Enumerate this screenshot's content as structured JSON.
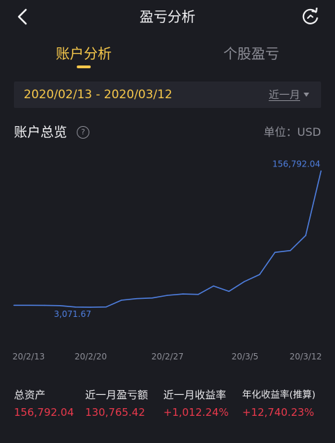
{
  "nav": {
    "title": "盈亏分析",
    "back_icon": "chevron-left-icon",
    "refresh_icon": "refresh-icon"
  },
  "tabs": [
    {
      "label": "账户分析",
      "active": true
    },
    {
      "label": "个股盈亏",
      "active": false
    }
  ],
  "date_bar": {
    "range": "2020/02/13 - 2020/03/12",
    "period": "近一月"
  },
  "overview": {
    "title": "账户总览",
    "help_icon": "question-circle-icon",
    "unit": "单位：USD"
  },
  "colors": {
    "accent": "#f5c74b",
    "line": "#4f7fe0",
    "negative": "#e9394c",
    "background": "#1b1c22"
  },
  "chart_data": {
    "type": "line",
    "title": "",
    "xlabel": "",
    "ylabel": "",
    "x_tick_labels": [
      "20/2/13",
      "20/2/20",
      "20/2/27",
      "20/3/5",
      "20/3/12"
    ],
    "x": [
      "20/2/13",
      "20/2/14",
      "20/2/17",
      "20/2/18",
      "20/2/19",
      "20/2/20",
      "20/2/21",
      "20/2/24",
      "20/2/25",
      "20/2/26",
      "20/2/27",
      "20/2/28",
      "20/3/2",
      "20/3/3",
      "20/3/4",
      "20/3/5",
      "20/3/6",
      "20/3/9",
      "20/3/10",
      "20/3/11",
      "20/3/12"
    ],
    "series": [
      {
        "values": [
          5300,
          5300,
          5200,
          4900,
          3300,
          3071.67,
          3400,
          11000,
          12800,
          13500,
          16500,
          18000,
          17500,
          27000,
          21000,
          32000,
          40000,
          65000,
          67000,
          84000,
          156792.04
        ]
      }
    ],
    "annotations": [
      {
        "text": "156,792.04",
        "at": "max"
      },
      {
        "text": "3,071.67",
        "at": "min"
      }
    ],
    "ylim": [
      0,
      165000
    ],
    "grid": false,
    "legend": "none"
  },
  "stats": [
    {
      "label": "总资产",
      "value": "156,792.04"
    },
    {
      "label": "近一月盈亏额",
      "value": "130,765.42"
    },
    {
      "label": "近一月收益率",
      "value": "+1,012.24%"
    },
    {
      "label": "年化收益率(推算)",
      "value": "+12,740.23%"
    }
  ]
}
